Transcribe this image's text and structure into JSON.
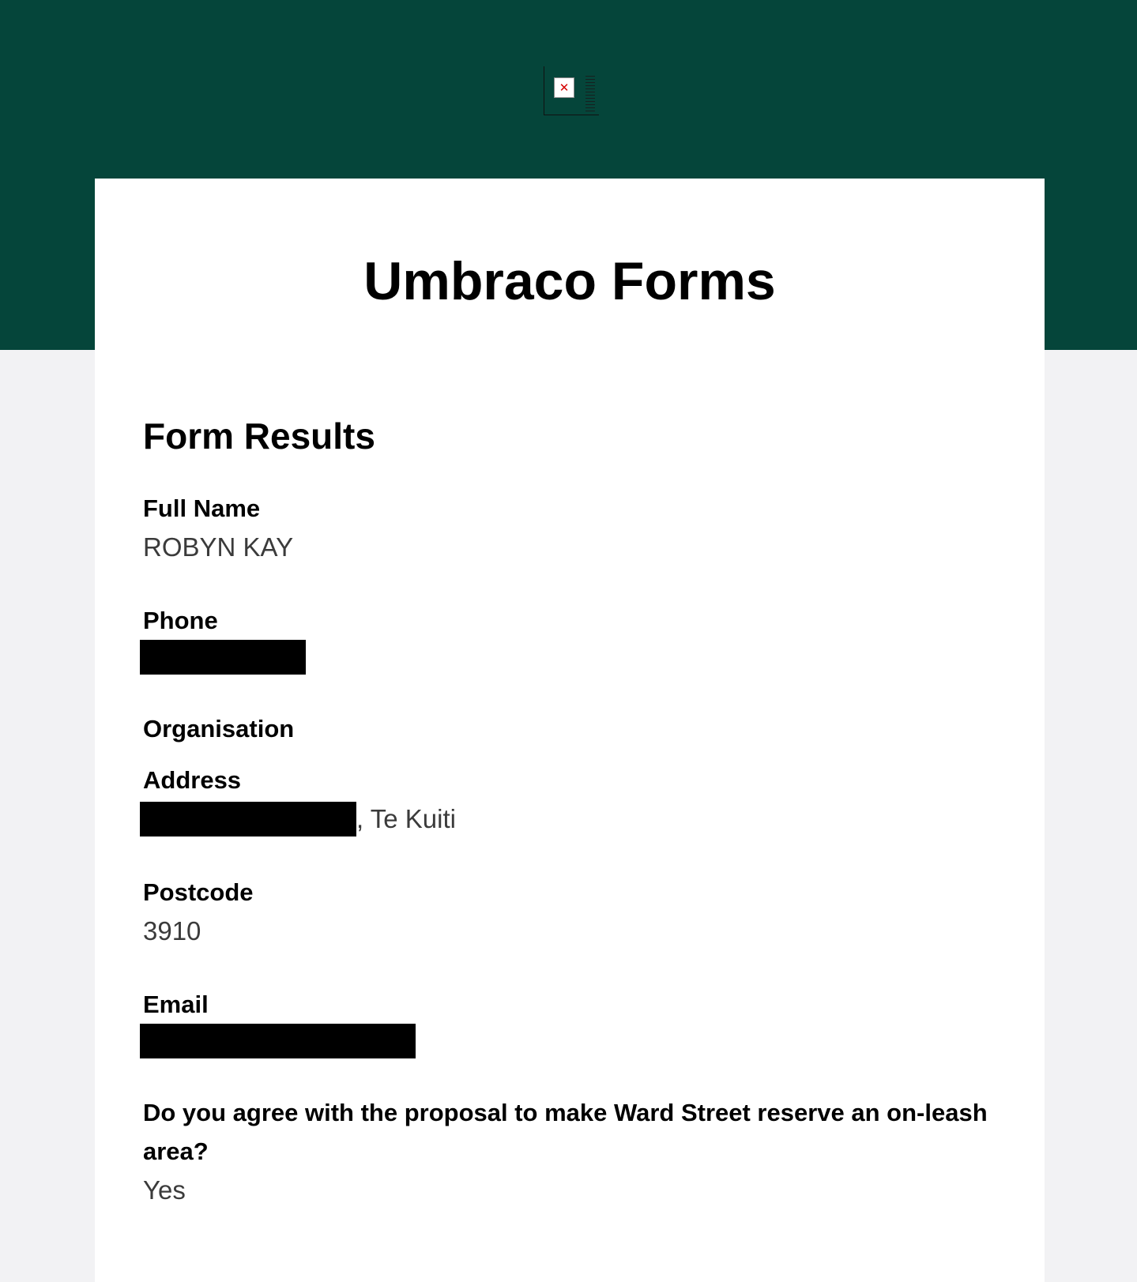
{
  "header": {
    "logo_icon": "broken-image-icon",
    "title": "Umbraco Forms"
  },
  "results": {
    "heading": "Form Results",
    "fields": [
      {
        "label": "Full Name",
        "value": "ROBYN KAY"
      },
      {
        "label": "Phone",
        "value": ""
      },
      {
        "label": "Organisation",
        "value": ""
      },
      {
        "label": "Address",
        "value_suffix": ", Te Kuiti"
      },
      {
        "label": "Postcode",
        "value": "3910"
      },
      {
        "label": "Email",
        "value": ""
      },
      {
        "label": "Do you agree with the proposal to make Ward Street reserve an on-leash area?",
        "value": "Yes"
      }
    ]
  },
  "colors": {
    "header_band": "#05453a",
    "page_background": "#f2f2f4",
    "card_background": "#ffffff",
    "redaction": "#000000"
  }
}
